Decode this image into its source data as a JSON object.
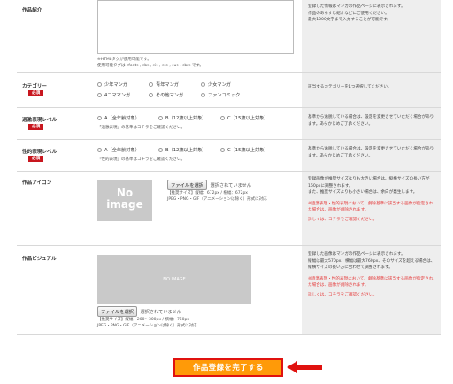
{
  "intro": {
    "label": "作品紹介",
    "note1": "※HTMLタグが使用可能です。",
    "note2": "使用可能タグは<font>,<b>,<i>,<s>,<u>,<br>です。",
    "right": [
      "登録した情報はマンガの作品ページに表示されます。",
      "作品のあらすじ紹介などにご使用ください。",
      "最大1000文字まで入力することが可能です。"
    ]
  },
  "category": {
    "label": "カテゴリー",
    "required": "必須",
    "options": [
      "少年マンガ",
      "青年マンガ",
      "少女マンガ",
      "4コママンガ",
      "その他マンガ",
      "ファンコミック"
    ],
    "right": "該当するカテゴリーを1つ選択してください。"
  },
  "violence": {
    "label": "過激表現レベル",
    "required": "必須",
    "options": [
      "A（全年齢対象）",
      "B（12歳以上対象）",
      "C（15歳以上対象）"
    ],
    "note": "「過激表現」の基準はコチラをご確認ください。",
    "right": [
      "基準から逸脱している場合は、設定を変更させていただく場合があります。あらかじめご了承ください。"
    ]
  },
  "sexual": {
    "label": "性的表現レベル",
    "required": "必須",
    "options": [
      "A（全年齢対象）",
      "B（12歳以上対象）",
      "C（15歳以上対象）"
    ],
    "note": "「性的表現」の基準はコチラをご確認ください。",
    "right": [
      "基準から逸脱している場合は、設定を変更させていただく場合があります。あらかじめご了承ください。"
    ]
  },
  "icon": {
    "label": "作品アイコン",
    "no_image_1": "No",
    "no_image_2": "image",
    "file_button": "ファイルを選択",
    "file_status": "選択されていません",
    "size_note": "【推奨サイズ】縦幅：672px / 横幅：672px",
    "format_note": "JPEG・PNG・GIF（アニメーションは除く）形式に対応",
    "right1": [
      "登録画像が推奨サイズよりも大きい場合は、縦横サイズの長い方が160pxに調整されます。",
      "また、推奨サイズよりも小さい場合は、余白が発生します。"
    ],
    "right_red": "※過激表現・性的表現において、劇除基準に該当する画像が指定された場合は、画像が劇除されます。",
    "right_link": "詳しくは、コチラをご確認ください。"
  },
  "visual": {
    "label": "作品ビジュアル",
    "no_image": "NO IMAGE",
    "file_button": "ファイルを選択",
    "file_status": "選択されていません",
    "size_note": "【推奨サイズ】縦幅：200〜300px / 横幅：760px",
    "format_note": "JPEG・PNG・GIF（アニメーションは除く）形式に対応",
    "right1": [
      "登録した画像はマンガの作品ページに表示されます。",
      "縦幅は最大570px、横幅は最大760px、そのサイズを超える場合は、縦横サイズの長い方に合わせて調整されます。"
    ],
    "right_red": "※過激表現・性的表現において、劇除基準に該当する画像が指定された場合は、画像が劇除されます。",
    "right_link": "詳しくは、コチラをご確認ください。"
  },
  "submit": {
    "label": "作品登録を完了する"
  },
  "colors": {
    "required_bg": "#c8161e",
    "submit_bg": "#ff9a08",
    "annotation": "#e0120f"
  }
}
